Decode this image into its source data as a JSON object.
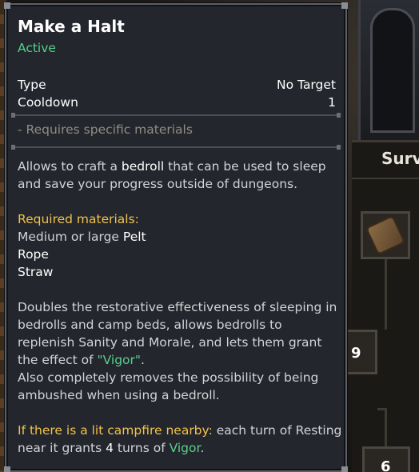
{
  "background": {
    "panel_title": "Surv",
    "slot_numbers": [
      "9",
      "6"
    ]
  },
  "tooltip": {
    "title": "Make a Halt",
    "status": "Active",
    "stats": [
      {
        "label": "Type",
        "value": "No Target"
      },
      {
        "label": "Cooldown",
        "value": "1"
      }
    ],
    "requirement": "- Requires specific materials",
    "description": {
      "p1": "Allows to craft a ",
      "p1_highlight": "bedroll",
      "p1_rest": " that can be used to sleep",
      "p2": "and save your progress outside of dungeons."
    },
    "materials": {
      "heading": "Required materials:",
      "line1_prefix": "Medium or large ",
      "line1_item": "Pelt",
      "line2": "Rope",
      "line3": "Straw"
    },
    "effect": {
      "l1": "Doubles the restorative effectiveness of sleeping in",
      "l2": "bedrolls and camp beds, allows bedrolls to",
      "l3": "replenish Sanity and Morale, and lets them grant",
      "l4_prefix": "the effect of ",
      "l4_highlight": "\"Vigor\"",
      "l4_suffix": ".",
      "l5": "Also completely removes the possibility of being",
      "l6": "ambushed when using a bedroll."
    },
    "campfire": {
      "condition": "If there is a lit campfire nearby:",
      "l1_rest": " each turn of Resting",
      "l2_prefix": "near it grants ",
      "l2_number": "4",
      "l2_middle": " turns of ",
      "l2_highlight": "Vigor",
      "l2_suffix": "."
    }
  },
  "colors": {
    "active": "#4fd387",
    "heading_yellow": "#f0c24c",
    "highlight_green": "#59cf8a",
    "body_text": "#d3d3d6",
    "muted": "#8f8d82"
  }
}
